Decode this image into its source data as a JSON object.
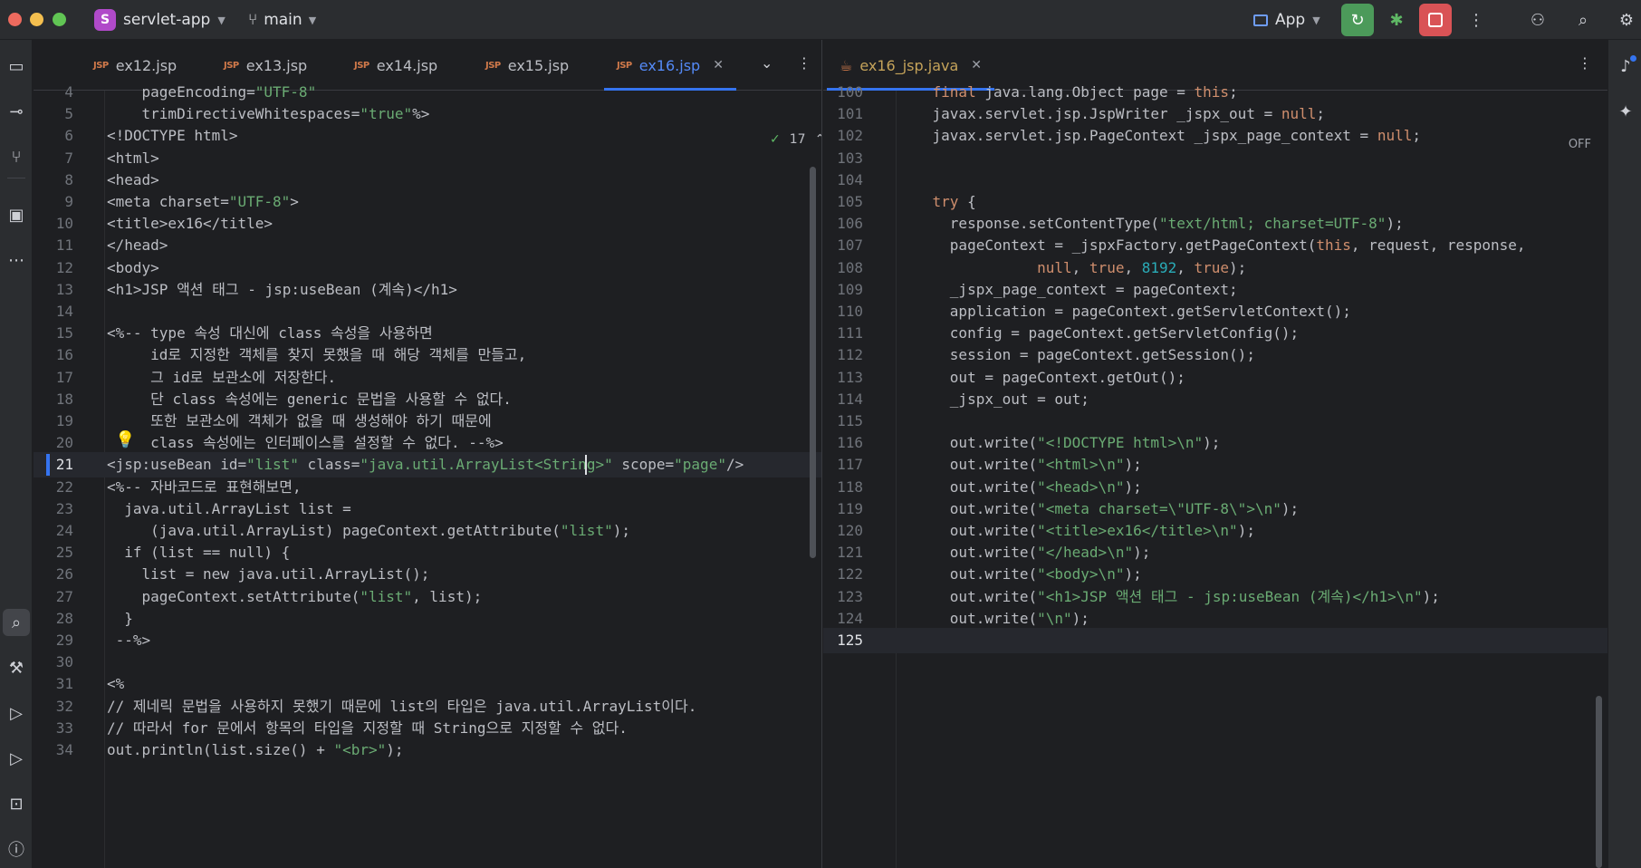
{
  "titlebar": {
    "project_initial": "S",
    "project_name": "servlet-app",
    "branch": "main",
    "run_config": "App"
  },
  "left_editor": {
    "tabs": [
      {
        "type": "JSP",
        "label": "ex12.jsp"
      },
      {
        "type": "JSP",
        "label": "ex13.jsp"
      },
      {
        "type": "JSP",
        "label": "ex14.jsp"
      },
      {
        "type": "JSP",
        "label": "ex15.jsp"
      },
      {
        "type": "JSP",
        "label": "ex16.jsp",
        "active": true
      }
    ],
    "inspection_count": "17",
    "current_line": 21,
    "lines": [
      {
        "n": "4",
        "text": "    pageEncoding=\"UTF-8\""
      },
      {
        "n": "5",
        "text": "    trimDirectiveWhitespaces=\"true\"%>"
      },
      {
        "n": "6",
        "text": "<!DOCTYPE html>"
      },
      {
        "n": "7",
        "text": "<html>"
      },
      {
        "n": "8",
        "text": "<head>"
      },
      {
        "n": "9",
        "text": "<meta charset=\"UTF-8\">"
      },
      {
        "n": "10",
        "text": "<title>ex16</title>"
      },
      {
        "n": "11",
        "text": "</head>"
      },
      {
        "n": "12",
        "text": "<body>"
      },
      {
        "n": "13",
        "text": "<h1>JSP 액션 태그 - jsp:useBean (계속)</h1>"
      },
      {
        "n": "14",
        "text": ""
      },
      {
        "n": "15",
        "text": "<%-- type 속성 대신에 class 속성을 사용하면"
      },
      {
        "n": "16",
        "text": "     id로 지정한 객체를 찾지 못했을 때 해당 객체를 만들고,"
      },
      {
        "n": "17",
        "text": "     그 id로 보관소에 저장한다."
      },
      {
        "n": "18",
        "text": "     단 class 속성에는 generic 문법을 사용할 수 없다."
      },
      {
        "n": "19",
        "text": "     또한 보관소에 객체가 없을 때 생성해야 하기 때문에"
      },
      {
        "n": "20",
        "text": "     class 속성에는 인터페이스를 설정할 수 없다. --%>"
      },
      {
        "n": "21",
        "text": "<jsp:useBean id=\"list\" class=\"java.util.ArrayList<String>\" scope=\"page\"/>"
      },
      {
        "n": "22",
        "text": "<%-- 자바코드로 표현해보면,"
      },
      {
        "n": "23",
        "text": "  java.util.ArrayList list ="
      },
      {
        "n": "24",
        "text": "     (java.util.ArrayList) pageContext.getAttribute(\"list\");"
      },
      {
        "n": "25",
        "text": "  if (list == null) {"
      },
      {
        "n": "26",
        "text": "    list = new java.util.ArrayList();"
      },
      {
        "n": "27",
        "text": "    pageContext.setAttribute(\"list\", list);"
      },
      {
        "n": "28",
        "text": "  }"
      },
      {
        "n": "29",
        "text": " --%>"
      },
      {
        "n": "30",
        "text": ""
      },
      {
        "n": "31",
        "text": "<%"
      },
      {
        "n": "32",
        "text": "// 제네릭 문법을 사용하지 못했기 때문에 list의 타입은 java.util.ArrayList이다."
      },
      {
        "n": "33",
        "text": "// 따라서 for 문에서 항목의 타입을 지정할 때 String으로 지정할 수 없다."
      },
      {
        "n": "34",
        "text": "out.println(list.size() + \"<br>\");"
      }
    ]
  },
  "right_editor": {
    "tabs": [
      {
        "type": "java",
        "label": "ex16_jsp.java",
        "active": true
      }
    ],
    "status": "OFF",
    "current_line": 125,
    "lines": [
      {
        "n": "100",
        "text": "    final java.lang.Object page = this;"
      },
      {
        "n": "101",
        "text": "    javax.servlet.jsp.JspWriter _jspx_out = null;"
      },
      {
        "n": "102",
        "text": "    javax.servlet.jsp.PageContext _jspx_page_context = null;"
      },
      {
        "n": "103",
        "text": ""
      },
      {
        "n": "104",
        "text": ""
      },
      {
        "n": "105",
        "text": "    try {"
      },
      {
        "n": "106",
        "text": "      response.setContentType(\"text/html; charset=UTF-8\");"
      },
      {
        "n": "107",
        "text": "      pageContext = _jspxFactory.getPageContext(this, request, response,"
      },
      {
        "n": "108",
        "text": "                null, true, 8192, true);"
      },
      {
        "n": "109",
        "text": "      _jspx_page_context = pageContext;"
      },
      {
        "n": "110",
        "text": "      application = pageContext.getServletContext();"
      },
      {
        "n": "111",
        "text": "      config = pageContext.getServletConfig();"
      },
      {
        "n": "112",
        "text": "      session = pageContext.getSession();"
      },
      {
        "n": "113",
        "text": "      out = pageContext.getOut();"
      },
      {
        "n": "114",
        "text": "      _jspx_out = out;"
      },
      {
        "n": "115",
        "text": ""
      },
      {
        "n": "116",
        "text": "      out.write(\"<!DOCTYPE html>\\n\");"
      },
      {
        "n": "117",
        "text": "      out.write(\"<html>\\n\");"
      },
      {
        "n": "118",
        "text": "      out.write(\"<head>\\n\");"
      },
      {
        "n": "119",
        "text": "      out.write(\"<meta charset=\\\"UTF-8\\\">\\n\");"
      },
      {
        "n": "120",
        "text": "      out.write(\"<title>ex16</title>\\n\");"
      },
      {
        "n": "121",
        "text": "      out.write(\"</head>\\n\");"
      },
      {
        "n": "122",
        "text": "      out.write(\"<body>\\n\");"
      },
      {
        "n": "123",
        "text": "      out.write(\"<h1>JSP 액션 태그 - jsp:useBean (계속)</h1>\\n\");"
      },
      {
        "n": "124",
        "text": "      out.write(\"\\n\");"
      },
      {
        "n": "125",
        "text": ""
      }
    ]
  },
  "colors": {
    "keyword": "#cf8e6d",
    "string": "#6aab73",
    "number": "#2aacb8",
    "text": "#bcbec4",
    "tag": "#bcbec4",
    "accent": "#3574f0"
  }
}
